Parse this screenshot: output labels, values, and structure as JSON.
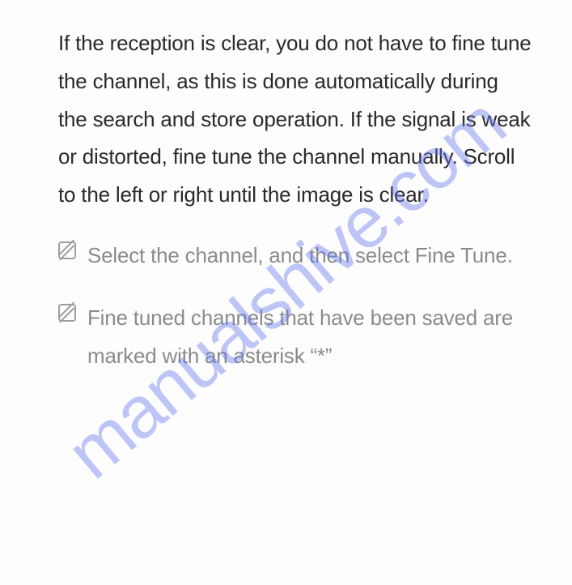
{
  "main_paragraph": "If the reception is clear, you do not have to fine tune the channel, as this is done automatically during the search and store operation. If the signal is weak or distorted, fine tune the channel manually. Scroll to the left or right until the image is clear.",
  "notes": [
    "Select the channel, and then select Fine Tune.",
    "Fine tuned channels that have been saved are marked with an asterisk “*”"
  ],
  "watermark": "manualshive.com"
}
